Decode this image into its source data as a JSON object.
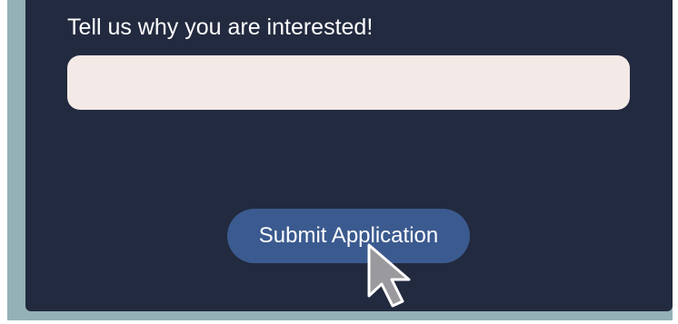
{
  "form": {
    "question_label": "Tell us why you are interested!",
    "answer_value": "",
    "answer_placeholder": "",
    "submit_label": "Submit Application"
  },
  "colors": {
    "page_background": "#93b1b6",
    "card_background": "#222a3f",
    "input_background": "#f3e9e6",
    "button_background": "#3b5a8f",
    "text": "#ffffff"
  },
  "icons": {
    "cursor": "mouse-pointer-icon"
  }
}
